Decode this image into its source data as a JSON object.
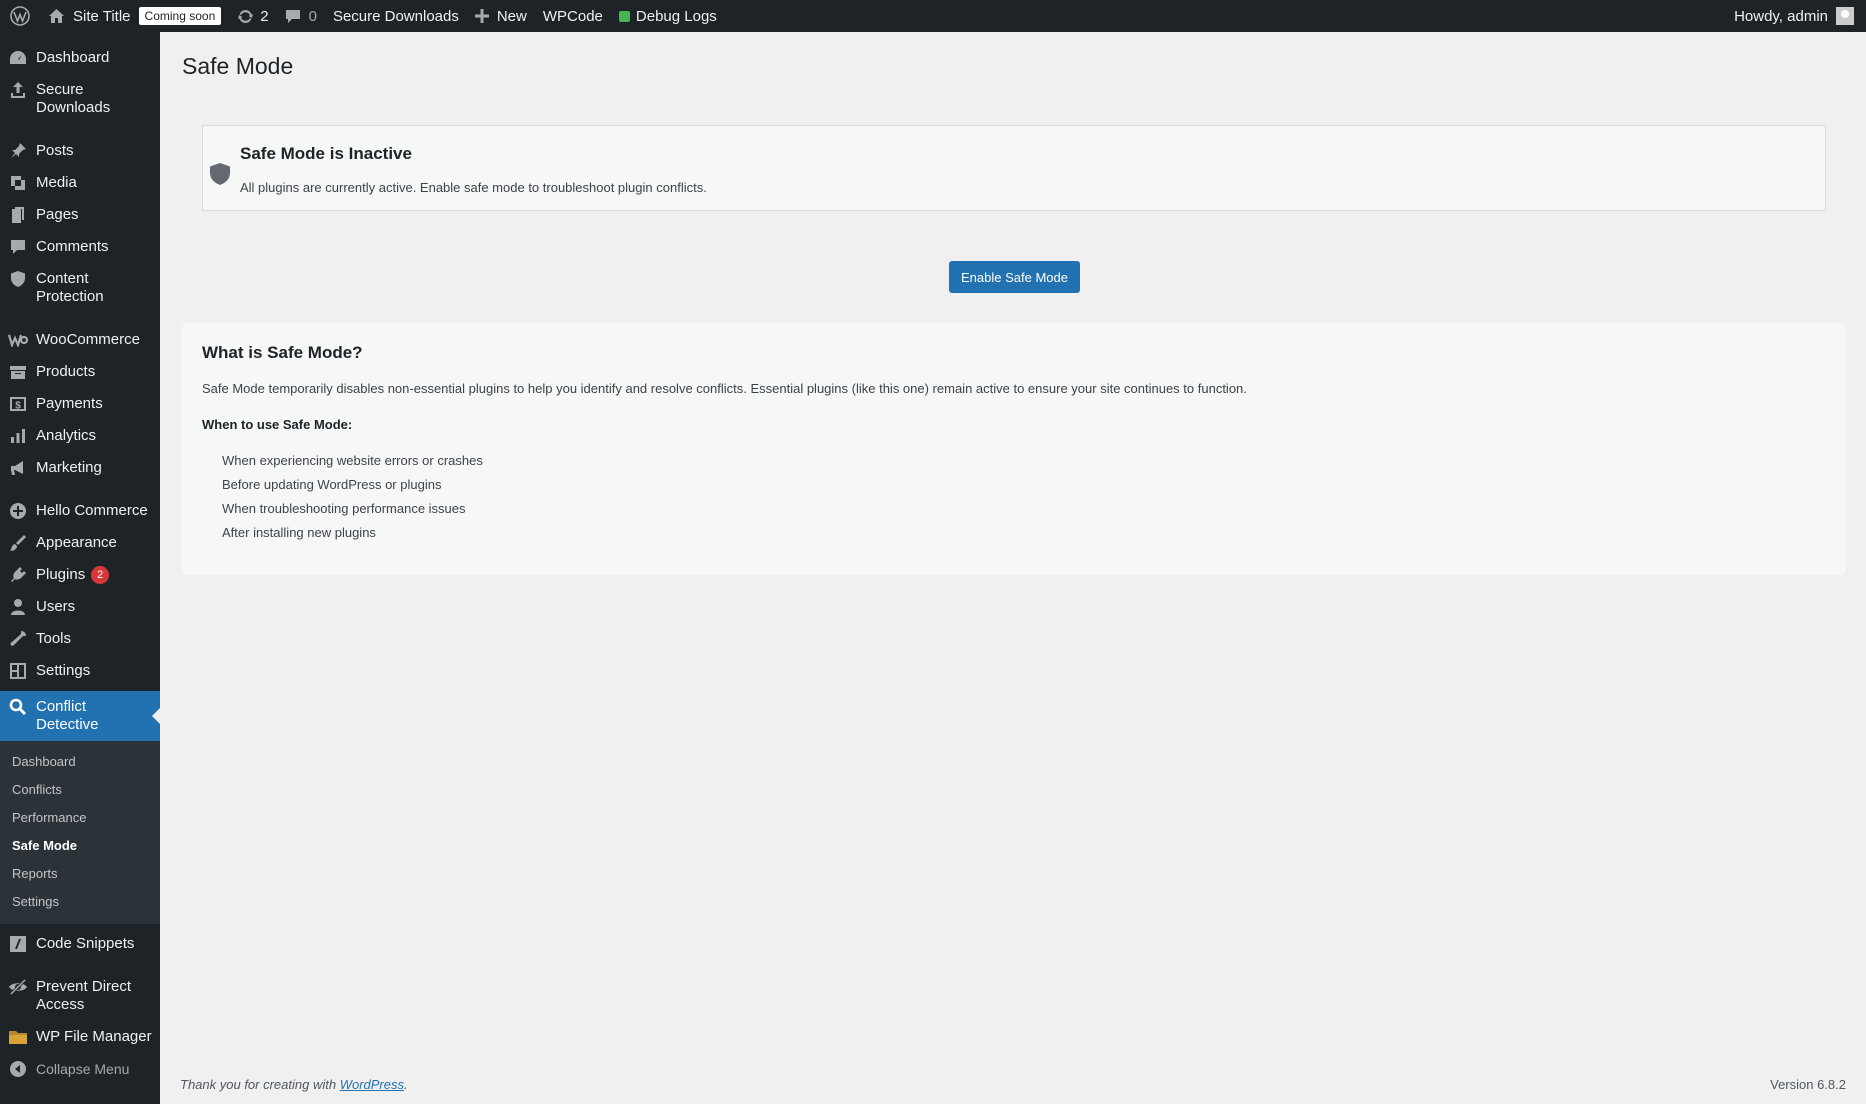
{
  "adminbar": {
    "site_title": "Site Title",
    "coming_soon": "Coming soon",
    "updates_count": "2",
    "comments_count": "0",
    "secure_downloads": "Secure Downloads",
    "new_label": "New",
    "wpcode": "WPCode",
    "debug_logs": "Debug Logs",
    "howdy": "Howdy, admin"
  },
  "sidebar": {
    "items": [
      {
        "label": "Dashboard",
        "icon": "dashboard-icon"
      },
      {
        "label": "Secure Downloads",
        "icon": "upload-icon"
      },
      {
        "label": "Posts",
        "icon": "pin-icon"
      },
      {
        "label": "Media",
        "icon": "media-icon"
      },
      {
        "label": "Pages",
        "icon": "pages-icon"
      },
      {
        "label": "Comments",
        "icon": "comment-icon"
      },
      {
        "label": "Content Protection",
        "icon": "shield-icon"
      },
      {
        "label": "WooCommerce",
        "icon": "woo-icon"
      },
      {
        "label": "Products",
        "icon": "archive-icon"
      },
      {
        "label": "Payments",
        "icon": "dollar-icon"
      },
      {
        "label": "Analytics",
        "icon": "bar-chart-icon"
      },
      {
        "label": "Marketing",
        "icon": "megaphone-icon"
      },
      {
        "label": "Hello Commerce",
        "icon": "plus-circle-icon"
      },
      {
        "label": "Appearance",
        "icon": "brush-icon"
      },
      {
        "label": "Plugins",
        "icon": "plug-icon",
        "badge": "2"
      },
      {
        "label": "Users",
        "icon": "user-icon"
      },
      {
        "label": "Tools",
        "icon": "wrench-icon"
      },
      {
        "label": "Settings",
        "icon": "settings-icon"
      },
      {
        "label": "Conflict Detective",
        "icon": "search-icon"
      },
      {
        "label": "Code Snippets",
        "icon": "code-icon"
      },
      {
        "label": "Prevent Direct Access",
        "icon": "hidden-eye-icon"
      },
      {
        "label": "WP File Manager",
        "icon": "folder-icon"
      },
      {
        "label": "Collapse Menu",
        "icon": "collapse-icon"
      }
    ],
    "submenu": [
      "Dashboard",
      "Conflicts",
      "Performance",
      "Safe Mode",
      "Reports",
      "Settings"
    ]
  },
  "main": {
    "title": "Safe Mode",
    "status_title": "Safe Mode is Inactive",
    "status_desc": "All plugins are currently active. Enable safe mode to troubleshoot plugin conflicts.",
    "enable_button": "Enable Safe Mode",
    "info_title": "What is Safe Mode?",
    "info_desc": "Safe Mode temporarily disables non-essential plugins to help you identify and resolve conflicts. Essential plugins (like this one) remain active to ensure your site continues to function.",
    "when_label": "When to use Safe Mode:",
    "when_list": [
      "When experiencing website errors or crashes",
      "Before updating WordPress or plugins",
      "When troubleshooting performance issues",
      "After installing new plugins"
    ]
  },
  "footer": {
    "thanks_prefix": "Thank you for creating with ",
    "wordpress_link": "WordPress",
    "thanks_suffix": ".",
    "version": "Version 6.8.2"
  },
  "colors": {
    "accent": "#2271b1",
    "sidebar_bg": "#1d2327",
    "submenu_bg": "#2c3338",
    "badge": "#d63638"
  }
}
